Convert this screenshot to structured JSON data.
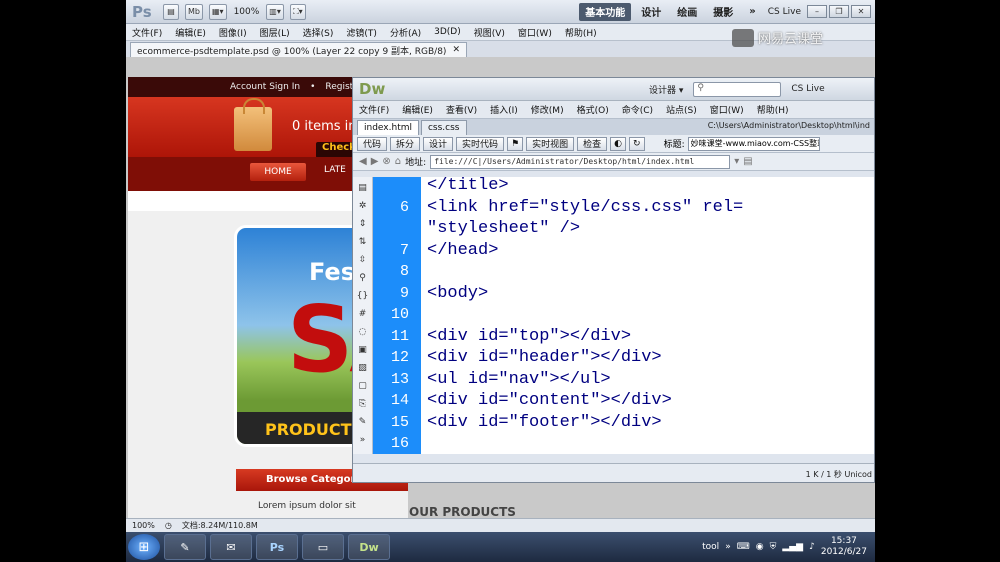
{
  "photoshop": {
    "logo": "Ps",
    "zoom": "100%",
    "workspace_active": "基本功能",
    "workspaces": [
      "设计",
      "绘画",
      "摄影"
    ],
    "more": "»",
    "cs_live": "CS Live",
    "menu": [
      "文件(F)",
      "编辑(E)",
      "图像(I)",
      "图层(L)",
      "选择(S)",
      "滤镜(T)",
      "分析(A)",
      "3D(D)",
      "视图(V)",
      "窗口(W)",
      "帮助(H)"
    ],
    "doc_tab": "ecommerce-psdtemplate.psd @ 100% (Layer 22 copy 9 副本, RGB/8)",
    "status_zoom": "100%",
    "status_doc": "文档:8.24M/110.8M"
  },
  "mockup": {
    "account": "Account Sign In",
    "register": "Regist",
    "cart": "0 items in",
    "checkout": "Check",
    "nav_home": "HOME",
    "nav_late": "LATE",
    "banner_fes": "Fes",
    "banner_sa": "SA",
    "banner_product": "PRODUCT",
    "browse": "Browse Categor",
    "lorem": "Lorem ipsum dolor sit",
    "our_products": "OUR PRODUCTS"
  },
  "dreamweaver": {
    "logo": "Dw",
    "designer": "设计器 ▾",
    "cs_live": "CS Live",
    "menu": [
      "文件(F)",
      "编辑(E)",
      "查看(V)",
      "插入(I)",
      "修改(M)",
      "格式(O)",
      "命令(C)",
      "站点(S)",
      "窗口(W)",
      "帮助(H)"
    ],
    "tabs": [
      "index.html",
      "css.css"
    ],
    "path": "C:\\Users\\Administrator\\Desktop\\html\\ind",
    "toolbar": {
      "code": "代码",
      "split": "拆分",
      "design": "设计",
      "live_code": "实时代码",
      "live_view": "实时视图",
      "inspect": "检查",
      "title_label": "标题:",
      "title_value": "妙味课堂-www.miaov.com-CSS整站"
    },
    "address_label": "地址:",
    "address": "file:///C|/Users/Administrator/Desktop/html/index.html",
    "code_lines": [
      {
        "num": "",
        "code": "</title>"
      },
      {
        "num": "6",
        "code": "<link href=\"style/css.css\" rel="
      },
      {
        "num": "",
        "code": "\"stylesheet\" />"
      },
      {
        "num": "7",
        "code": "</head>"
      },
      {
        "num": "8",
        "code": ""
      },
      {
        "num": "9",
        "code": "<body>"
      },
      {
        "num": "10",
        "code": ""
      },
      {
        "num": "11",
        "code": "<div id=\"top\"></div>"
      },
      {
        "num": "12",
        "code": "<div id=\"header\"></div>"
      },
      {
        "num": "13",
        "code": "<ul id=\"nav\"></ul>"
      },
      {
        "num": "14",
        "code": "<div id=\"content\"></div>"
      },
      {
        "num": "15",
        "code": "<div id=\"footer\"></div>"
      },
      {
        "num": "16",
        "code": ""
      }
    ],
    "status": "1 K / 1 秒  Unicod"
  },
  "taskbar": {
    "apps": [
      "Ps",
      "Dw"
    ],
    "tool": "tool",
    "time": "15:37",
    "date": "2012/6/27"
  },
  "watermark": "网易云课堂"
}
